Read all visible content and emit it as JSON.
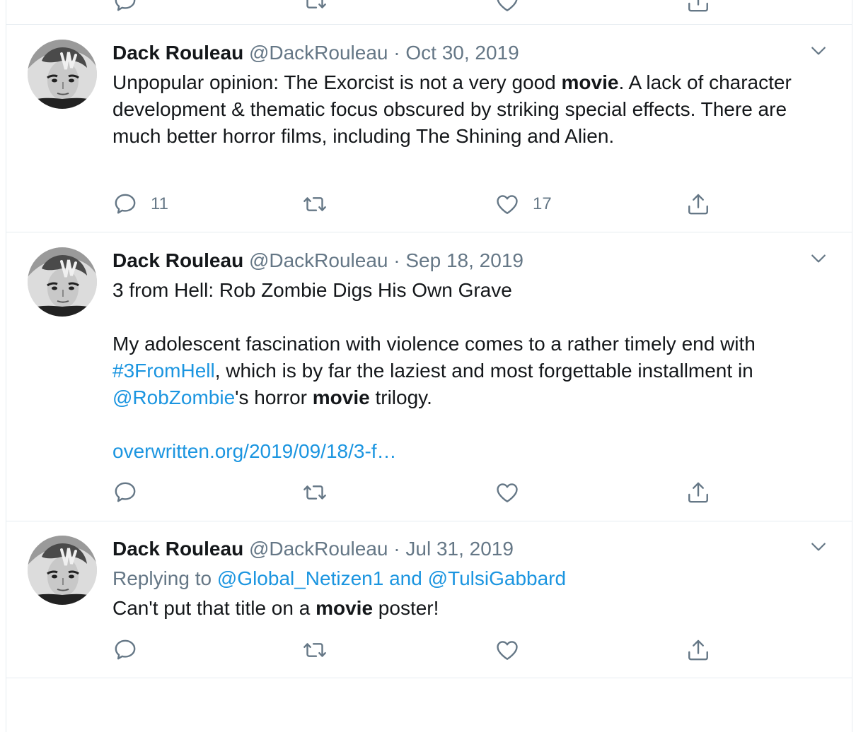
{
  "colors": {
    "text": "#14171a",
    "secondary": "#657786",
    "link": "#1b95e0",
    "border": "#e6ecf0"
  },
  "icons": {
    "reply": "reply-icon",
    "retweet": "retweet-icon",
    "like": "like-icon",
    "share": "share-icon",
    "menu": "chevron-down-icon"
  },
  "tweets": [
    {
      "name": "Dack Rouleau",
      "handle": "@DackRouleau",
      "separator": "·",
      "date": "Oct 30, 2019",
      "text_1": "Unpopular opinion: The Exorcist is not a very good ",
      "bold": "movie",
      "text_2": ". A lack of character development & thematic focus obscured by striking special effects. There are much better horror films, including The Shining and Alien.",
      "reply_count": "11",
      "retweet_count": "",
      "like_count": "17"
    },
    {
      "name": "Dack Rouleau",
      "handle": "@DackRouleau",
      "separator": "·",
      "date": "Sep 18, 2019",
      "title": "3 from Hell: Rob Zombie Digs His Own Grave",
      "para_1": "My adolescent fascination with violence comes to a rather timely end with ",
      "hashtag": "#3FromHell",
      "para_2": ", which is by far the laziest and most forgettable installment in ",
      "mention": "@RobZombie",
      "para_3": "'s horror ",
      "bold": "movie",
      "para_4": " trilogy.",
      "url": "overwritten.org/2019/09/18/3-f…",
      "reply_count": "",
      "retweet_count": "",
      "like_count": ""
    },
    {
      "name": "Dack Rouleau",
      "handle": "@DackRouleau",
      "separator": "·",
      "date": "Jul 31, 2019",
      "replying_prefix": "Replying to ",
      "replying_users": "@Global_Netizen1 and @TulsiGabbard",
      "text_1": "Can't put that title on a ",
      "bold": "movie",
      "text_2": " poster!",
      "reply_count": "",
      "retweet_count": "",
      "like_count": ""
    }
  ]
}
